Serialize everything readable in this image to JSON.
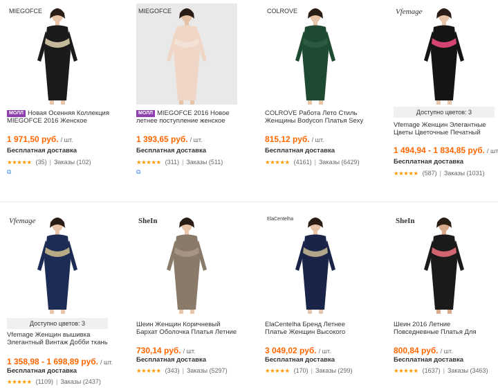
{
  "products": [
    {
      "brand": "MIEGOFCE",
      "colors": {
        "bg": "#ffffff",
        "dress": "#1b1b1b",
        "accent": "#d8cca8",
        "skin": "#e8c4a8"
      },
      "mall_badge": "МОЛЛ",
      "title": "Новая Осенняя Коллекция MIEGOFCE 2016 Женское",
      "price": "1 971,50 руб.",
      "unit": "/ шт.",
      "shipping": "Бесплатная доставка",
      "stars": "★★★★★",
      "rating_count": "(35)",
      "orders": "Заказы (102)",
      "extra_icon": "coupon-icon"
    },
    {
      "brand": "MIEGOFCE",
      "colors": {
        "bg": "#e9e9e9",
        "dress": "#efd6c6",
        "accent": "#f4e2d6",
        "skin": "#e6c2a6"
      },
      "mall_badge": "МОЛЛ",
      "title": "MIEGOFCE 2016 Новое летнее поступление женское",
      "price": "1 393,65 руб.",
      "unit": "/ шт.",
      "shipping": "Бесплатная доставка",
      "stars": "★★★★★",
      "rating_count": "(311)",
      "orders": "Заказы (511)",
      "extra_icon": "coupon-icon"
    },
    {
      "brand": "COLROVE",
      "colors": {
        "bg": "#ffffff",
        "dress": "#1f4a32",
        "accent": "#2b5c40",
        "skin": "#e8c4a8"
      },
      "mall_badge": "",
      "title": "COLROVE Работа Лето Стиль Женщины Bodycon Платья Sexy",
      "price": "815,12 руб.",
      "unit": "/ шт.",
      "shipping": "Бесплатная доставка",
      "stars": "★★★★★",
      "rating_count": "(4161)",
      "orders": "Заказы (6429)",
      "extra_icon": ""
    },
    {
      "brand": "Vfemage",
      "colors": {
        "bg": "#ffffff",
        "dress": "#141414",
        "accent": "#e84a7a",
        "skin": "#e8c4a8"
      },
      "available": "Доступно цветов: 3",
      "mall_badge": "",
      "title": "Vfemage Женщин Элегантные Цветы Цветочные Печатный",
      "price": "1 494,94 - 1 834,85 руб.",
      "unit": "/ шт.",
      "shipping": "Бесплатная доставка",
      "stars": "★★★★★",
      "rating_count": "(587)",
      "orders": "Заказы (1031)",
      "extra_icon": ""
    },
    {
      "brand": "Vfemage",
      "colors": {
        "bg": "#ffffff",
        "dress": "#1d2c55",
        "accent": "#c9b98c",
        "skin": "#e8c4a8"
      },
      "available": "Доступно цветов: 3",
      "mall_badge": "",
      "title": "Vfemage Женщин вышивка Элегантный Винтаж Добби ткань",
      "price": "1 358,98 - 1 698,89 руб.",
      "unit": "/ шт.",
      "shipping": "Бесплатная доставка",
      "stars": "★★★★★",
      "rating_count": "(1109)",
      "orders": "Заказы (2437)",
      "extra_icon": ""
    },
    {
      "brand": "SheIn",
      "colors": {
        "bg": "#ffffff",
        "dress": "#8a7a6a",
        "accent": "#a89888",
        "skin": "#e8c4a8"
      },
      "mall_badge": "",
      "title": "Шеин Женщин Коричневый Бархат Оболочка Платья Летние",
      "price": "730,14 руб.",
      "unit": "/ шт.",
      "shipping": "Бесплатная доставка",
      "stars": "★★★★★",
      "rating_count": "(343)",
      "orders": "Заказы (5297)",
      "extra_icon": ""
    },
    {
      "brand": "ElaCentelha",
      "colors": {
        "bg": "#ffffff",
        "dress": "#1a2448",
        "accent": "#c2b590",
        "skin": "#e8c4a8"
      },
      "mall_badge": "",
      "title": "ElaCentelha Бренд Летнее Платье Женщин Высокого",
      "price": "3 049,02 руб.",
      "unit": "/ шт.",
      "shipping": "Бесплатная доставка",
      "stars": "★★★★★",
      "rating_count": "(170)",
      "orders": "Заказы (299)",
      "extra_icon": ""
    },
    {
      "brand": "SheIn",
      "colors": {
        "bg": "#ffffff",
        "dress": "#1a1a1a",
        "accent": "#e76b7a",
        "skin": "#d9a888"
      },
      "mall_badge": "",
      "title": "Шеин 2016 Летние Повседневные Платья Для",
      "price": "800,84 руб.",
      "unit": "/ шт.",
      "shipping": "Бесплатная доставка",
      "stars": "★★★★★",
      "rating_count": "(1637)",
      "orders": "Заказы (3463)",
      "extra_icon": ""
    }
  ]
}
